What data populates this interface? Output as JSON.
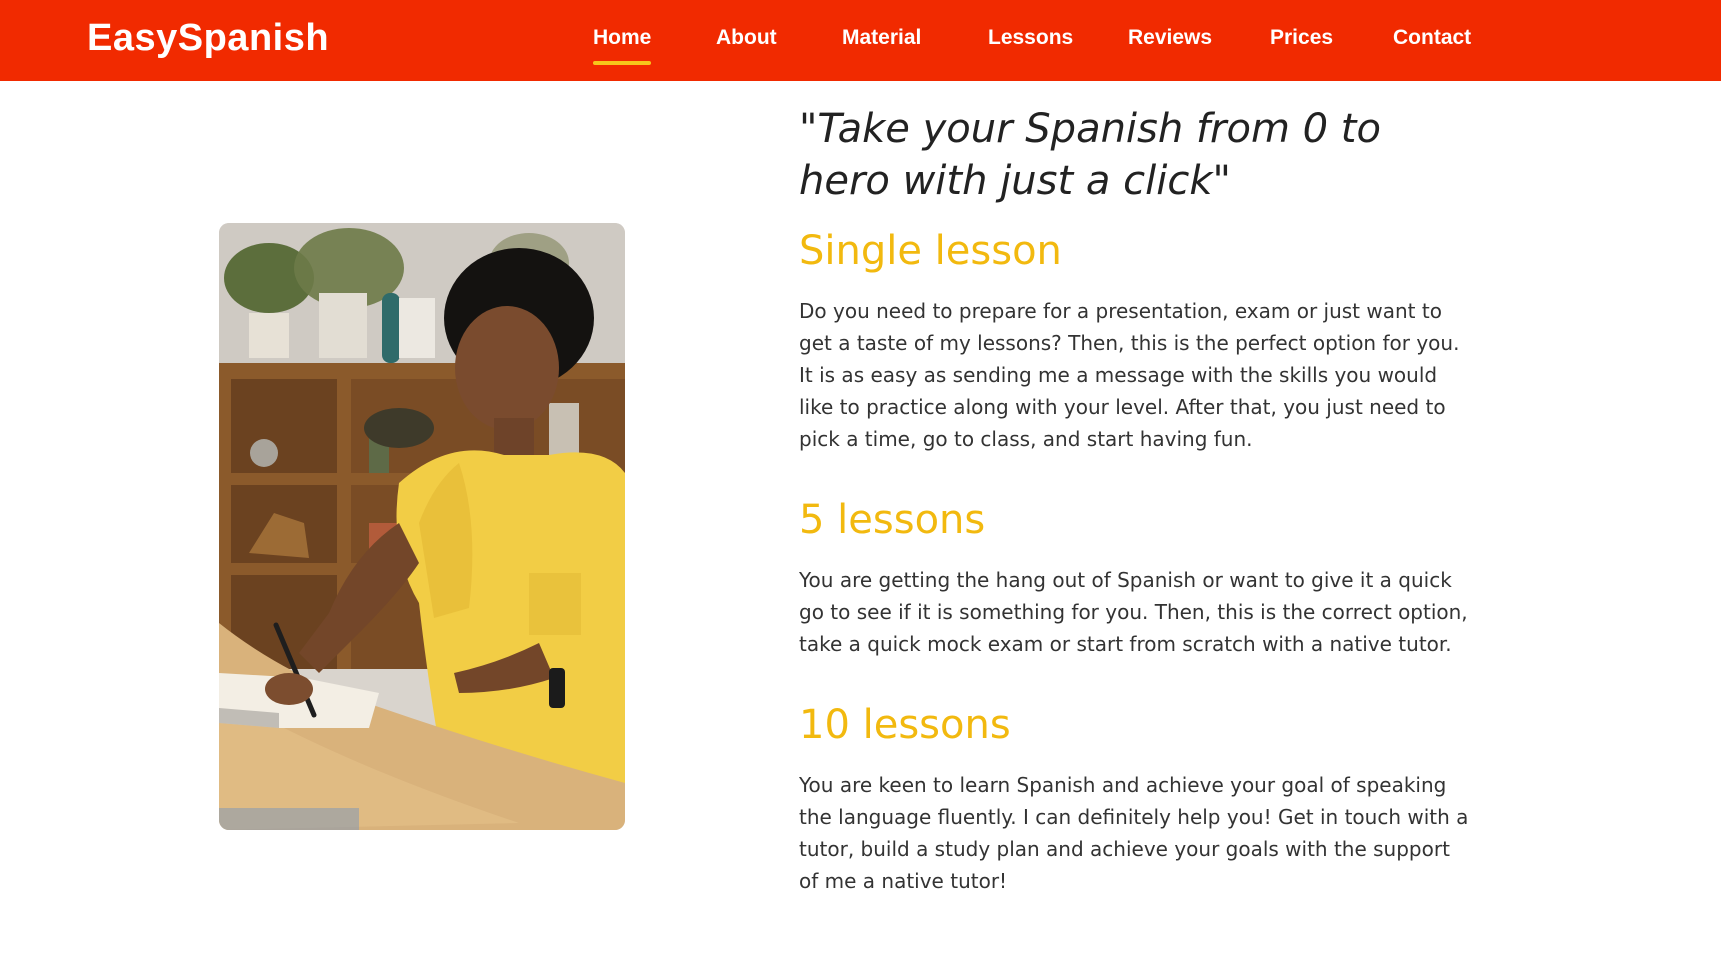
{
  "header": {
    "brand": "EasySpanish",
    "nav": [
      {
        "label": "Home",
        "active": true
      },
      {
        "label": "About"
      },
      {
        "label": "Material"
      },
      {
        "label": "Lessons"
      },
      {
        "label": "Reviews"
      },
      {
        "label": "Prices"
      },
      {
        "label": "Contact"
      }
    ]
  },
  "main": {
    "quote": "\"Take your Spanish from 0 to hero with just a click\"",
    "sections": [
      {
        "title": "Single lesson",
        "paragraphs": [
          "Do you need to prepare for a presentation, exam or just want to get a taste of my lessons? Then, this is the perfect option for you.",
          "It is as easy as sending me a message with the skills you would like to practice along with your level. After that, you just need to pick a time, go to class, and start having fun."
        ]
      },
      {
        "title": "5 lessons",
        "paragraphs": [
          "You are getting the hang out of Spanish or want to give it a quick go to see if it is something for you. Then, this is the correct option, take a quick mock exam or start from scratch with a native tutor."
        ]
      },
      {
        "title": "10 lessons",
        "paragraphs": [
          "You are keen to learn Spanish and achieve your goal of speaking the language fluently. I can definitely help you! Get in touch with a tutor, build a study plan and achieve your goals with the support of me a native tutor!"
        ]
      }
    ]
  },
  "colors": {
    "header_bg": "#f12a00",
    "accent": "#f2b90f",
    "active_underline": "#f7c61b"
  }
}
